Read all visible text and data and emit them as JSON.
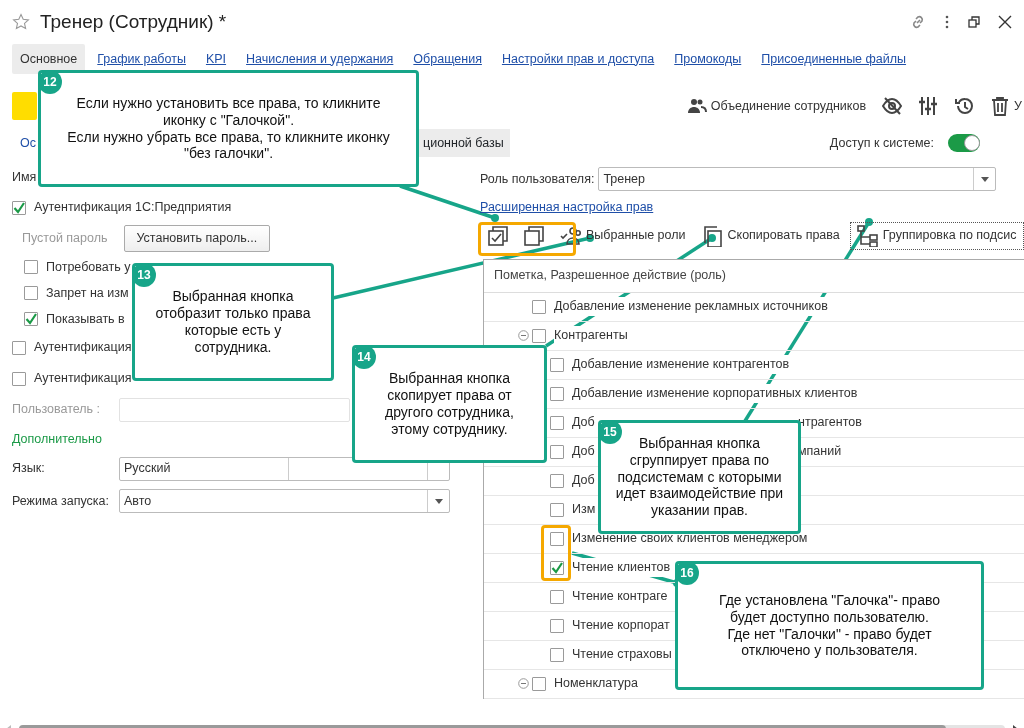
{
  "window": {
    "title": "Тренер (Сотрудник) *"
  },
  "tabs": [
    {
      "label": "Основное",
      "selected": true
    },
    {
      "label": "График работы",
      "selected": false
    },
    {
      "label": "KPI",
      "selected": false
    },
    {
      "label": "Начисления и удержания",
      "selected": false
    },
    {
      "label": "Обращения",
      "selected": false
    },
    {
      "label": "Настройки прав и доступа",
      "selected": false
    },
    {
      "label": "Промокоды",
      "selected": false
    },
    {
      "label": "Присоединенные файлы",
      "selected": false
    }
  ],
  "header_actions": [
    {
      "kind": "merge",
      "label": "Объединение сотрудников"
    },
    {
      "kind": "hide"
    },
    {
      "kind": "settings"
    },
    {
      "kind": "history"
    },
    {
      "kind": "delete",
      "label": "У"
    }
  ],
  "subtabs": [
    {
      "label": "Ос",
      "selected": false
    },
    {
      "label": "ционной базы",
      "selected": true
    }
  ],
  "access": {
    "label": "Доступ к системе:",
    "on": true
  },
  "user_form": [
    {
      "kind": "label",
      "text": "Имя"
    },
    {
      "kind": "checkbox",
      "label": "Аутентификация 1С:Предприятия",
      "checked": true,
      "children": [
        {
          "kind": "button_row",
          "label": "Пустой пароль",
          "button": "Установить пароль..."
        },
        {
          "kind": "checkbox",
          "label": "Потребовать у",
          "checked": false
        },
        {
          "kind": "checkbox",
          "label": "Запрет на изм",
          "checked": false
        },
        {
          "kind": "checkbox",
          "label": "Показывать в",
          "checked": true
        }
      ]
    },
    {
      "kind": "checkbox",
      "label": "Аутентификация",
      "checked": false
    },
    {
      "kind": "checkbox",
      "label": "Аутентификация",
      "checked": false
    },
    {
      "kind": "field",
      "label": "Пользователь :",
      "disabled": true
    },
    {
      "kind": "section",
      "text": "Дополнительно"
    },
    {
      "kind": "field",
      "label": "Язык:",
      "value": "Русский",
      "disabled": false
    },
    {
      "kind": "select",
      "label": "Режима запуска:",
      "value": "Авто"
    }
  ],
  "role": {
    "label": "Роль пользователя:",
    "value": "Тренер"
  },
  "advanced_link": "Расширенная настройка прав",
  "rights_toolbar": [
    {
      "kind": "check_all"
    },
    {
      "kind": "uncheck_all"
    },
    {
      "kind": "roles",
      "label": "Выбранные роли"
    },
    {
      "kind": "copy",
      "label": "Скопировать права"
    },
    {
      "kind": "grouping",
      "label": "Группировка по подсис"
    }
  ],
  "rights_table": {
    "column": "Пометка, Разрешенное действие (роль)",
    "rows": [
      {
        "label": "Добавление изменение рекламных источников",
        "checked": false
      },
      {
        "label": "Контрагенты",
        "checked": false,
        "expanded": true,
        "children": [
          {
            "label": "Добавление изменение контрагентов",
            "checked": false
          },
          {
            "label": "Добавление изменение корпоративных клиентов",
            "checked": false
          },
          {
            "label": "Доб",
            "tail": "нтрагентов",
            "checked": false
          },
          {
            "label": "Доб",
            "tail": "мпаний",
            "checked": false
          },
          {
            "label": "Доб",
            "checked": false
          },
          {
            "label": "Изм",
            "checked": false
          },
          {
            "label": "Изменение своих клиентов менеджером",
            "checked": false
          },
          {
            "label": "Чтение клиентов",
            "checked": true
          },
          {
            "label": "Чтение контраге",
            "checked": false
          },
          {
            "label": "Чтение корпорат",
            "checked": false
          },
          {
            "label": "Чтение страховы",
            "checked": false
          }
        ]
      },
      {
        "label": "Номенклатура",
        "checked": false,
        "expanded": true
      }
    ]
  },
  "callouts": [
    {
      "number": "12",
      "text": "Если нужно установить все права, то кликните иконку с \"Галочкой\".\nЕсли нужно убрать все права, то кликните иконку \"без галочки\"."
    },
    {
      "number": "13",
      "text": "Выбранная кнопка отобразит только права которые есть у сотрудника."
    },
    {
      "number": "14",
      "text": "Выбранная кнопка скопирует права от другого сотрудника, этому сотруднику."
    },
    {
      "number": "15",
      "text": "Выбранная кнопка сгруппирует права по подсистемам с которыми идет взаимодействие при указании прав."
    },
    {
      "number": "16",
      "text": "Где установлена \"Галочка\"- право будет доступно пользователю.\nГде нет \"Галочки\" - право  будет отключено у пользователя."
    }
  ]
}
